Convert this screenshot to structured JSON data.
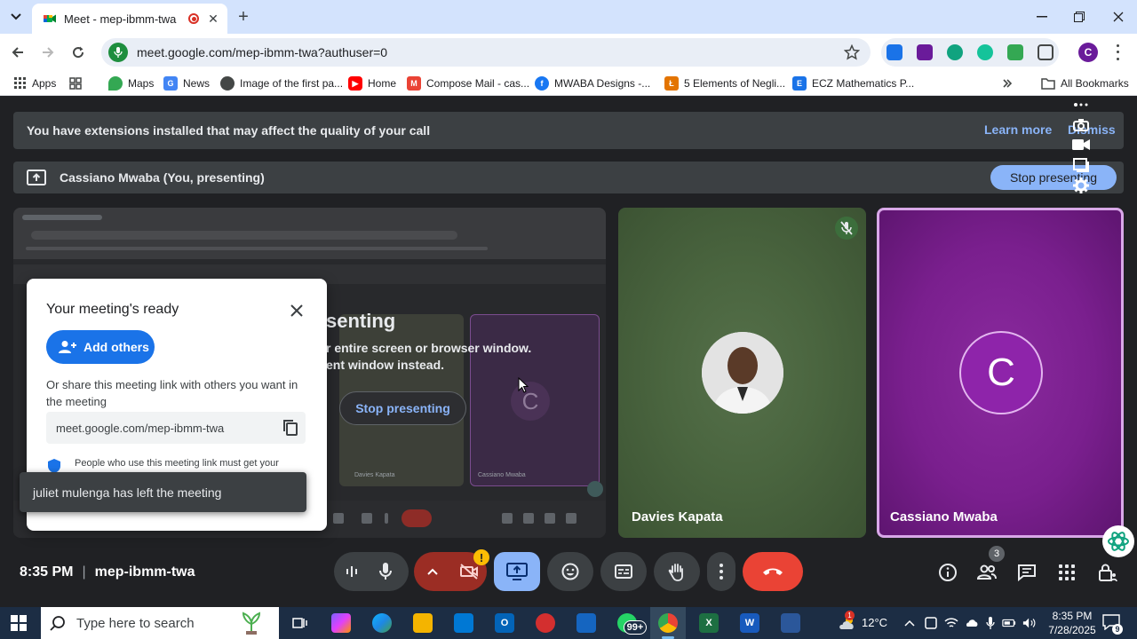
{
  "browser": {
    "tab_title": "Meet - mep-ibmm-twa",
    "url": "meet.google.com/mep-ibmm-twa?authuser=0",
    "profile_initial": "C",
    "bookmarks": [
      {
        "label": "Apps",
        "icon": "apps-grid-icon"
      },
      {
        "label": "",
        "icon": "tab-group-icon"
      },
      {
        "label": "Maps",
        "icon": "maps-icon"
      },
      {
        "label": "News",
        "icon": "news-icon"
      },
      {
        "label": "Image of the first pa...",
        "icon": "globe-icon"
      },
      {
        "label": "Home",
        "icon": "youtube-icon"
      },
      {
        "label": "Compose Mail - cas...",
        "icon": "gmail-icon"
      },
      {
        "label": "MWABA Designs -...",
        "icon": "facebook-icon"
      },
      {
        "label": "5 Elements of Negli...",
        "icon": "law-icon"
      },
      {
        "label": "ECZ Mathematics P...",
        "icon": "ecz-icon"
      }
    ],
    "all_bookmarks": "All Bookmarks"
  },
  "meet": {
    "extension_banner": "You have extensions installed that may affect the quality of your call",
    "learn_more": "Learn more",
    "dismiss": "Dismiss",
    "presenting_label": "Cassiano Mwaba (You, presenting)",
    "stop_presenting": "Stop presenting",
    "share_preview": {
      "presenting_title": "senting",
      "line1": "r entire screen or browser window.",
      "line2": "ent window instead.",
      "stop_presenting": "Stop presenting",
      "tile_a_name": "Davies Kapata",
      "tile_b_name": "Cassiano Mwaba",
      "tile_b_initial": "C"
    },
    "dialog": {
      "title": "Your meeting's ready",
      "add_others": "Add others",
      "description": "Or share this meeting link with others you want in the meeting",
      "link": "meet.google.com/mep-ibmm-twa",
      "security_note": "People who use this meeting link must get your"
    },
    "toast": "juliet mulenga has left the meeting",
    "participants": [
      {
        "name": "Davies Kapata",
        "muted": true
      },
      {
        "name": "Cassiano Mwaba",
        "initial": "C"
      }
    ],
    "time": "8:35 PM",
    "meeting_code": "mep-ibmm-twa",
    "people_count": "3",
    "warning_mark": "!",
    "colors": {
      "accent": "#8ab4f8",
      "end_call": "#ea4335",
      "tile_purple": "#7a1f8e",
      "tile_green": "#4a653f"
    }
  },
  "taskbar": {
    "search_placeholder": "Type here to search",
    "whatsapp_badge": "99+",
    "weather_badge": "1",
    "temperature": "12°C",
    "time": "8:35 PM",
    "date": "7/28/2025",
    "notification_count": "9"
  }
}
